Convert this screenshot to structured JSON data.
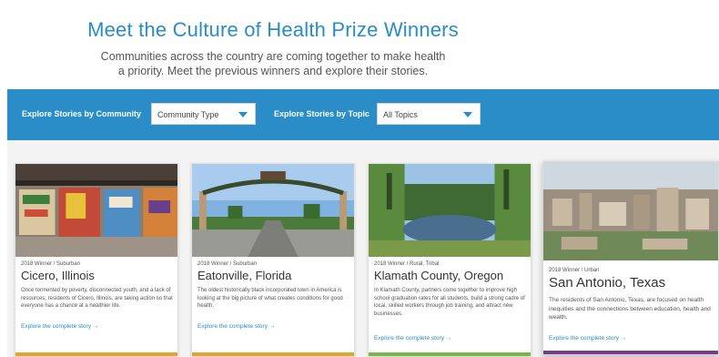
{
  "header": {
    "title": "Meet the Culture of Health Prize Winners",
    "subtitle_line1": "Communities across the country are coming together to make health",
    "subtitle_line2": "a priority. Meet the previous winners and explore their stories."
  },
  "filters": {
    "community_label": "Explore Stories by Community",
    "community_selected": "Community Type",
    "topic_label": "Explore Stories by Topic",
    "topic_selected": "All Topics"
  },
  "colors": {
    "brand_blue": "#2a8dc8",
    "bar_orange": "#e8a22c",
    "bar_green": "#79b544",
    "bar_purple": "#7a3a8c"
  },
  "cards": [
    {
      "meta": "2018 Winner / Suburban",
      "city": "Cicero, Illinois",
      "desc": "Once tormented by poverty, disconnected youth, and a lack of resources, residents of Cicero, Illinois, are taking action so that everyone has a chance at a healthier life.",
      "link": "Explore the complete story →"
    },
    {
      "meta": "2018 Winner / Suburban",
      "city": "Eatonville, Florida",
      "desc": "The oldest historically black incorporated town in America is looking at the big picture of what creates conditions for good health.",
      "link": "Explore the complete story →"
    },
    {
      "meta": "2018 Winner / Rural, Tribal",
      "city": "Klamath County, Oregon",
      "desc": "In Klamath County, partners come together to improve high school graduation rates for all students, build a strong cadre of local, skilled workers through job training, and attract new businesses.",
      "link": "Explore the complete story →"
    },
    {
      "meta": "2018 Winner / Urban",
      "city": "San Antonio, Texas",
      "desc": "The residents of San Antonio, Texas, are focused on health inequities and the connections between education, health and wealth.",
      "link": "Explore the complete story →"
    }
  ]
}
